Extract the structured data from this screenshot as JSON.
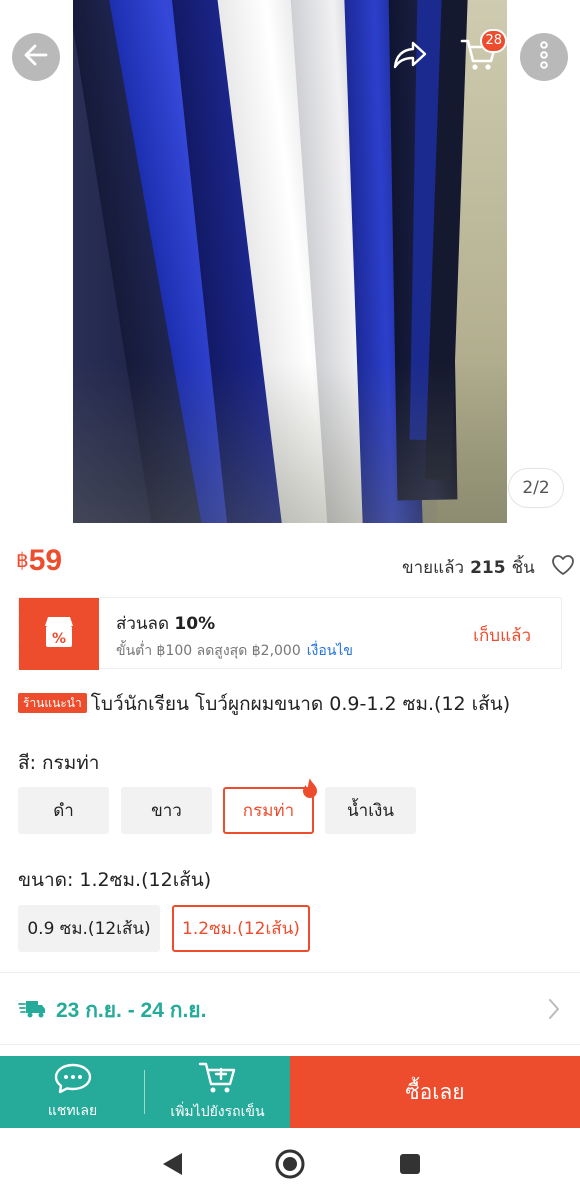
{
  "gallery": {
    "page_indicator": "2/2"
  },
  "header": {
    "cart_count": "28"
  },
  "price": {
    "currency": "฿",
    "amount": "59"
  },
  "sold": {
    "prefix": "ขายแล้ว",
    "count": "215",
    "suffix": "ชิ้น"
  },
  "voucher": {
    "title_prefix": "ส่วนลด",
    "title_value": "10%",
    "subtitle": "ขั้นต่ำ ฿100 ลดสูงสุด ฿2,000",
    "conditions_link": "เงื่อนไข",
    "action_label": "เก็บแล้ว"
  },
  "product": {
    "badge": "ร้านแนะนำ",
    "title": "โบว์นักเรียน โบว์ผูกผมขนาด 0.9-1.2 ซม.(12 เส้น)"
  },
  "color": {
    "label": "สี: กรมท่า",
    "options": [
      "ดำ",
      "ขาว",
      "กรมท่า",
      "น้ำเงิน"
    ],
    "selected": "กรมท่า"
  },
  "size": {
    "label": "ขนาด: 1.2ซม.(12เส้น)",
    "options": [
      "0.9 ซม.(12เส้น)",
      "1.2ซม.(12เส้น)"
    ],
    "selected": "1.2ซม.(12เส้น)"
  },
  "shipping": {
    "date_range": "23 ก.ย. - 24 ก.ย."
  },
  "bottom_bar": {
    "chat_label": "แชทเลย",
    "add_to_cart_label": "เพิ่มไปยังรถเข็น",
    "buy_label": "ซื้อเลย"
  },
  "colors": {
    "accent": "#ee4d2d",
    "teal": "#26aa99"
  }
}
